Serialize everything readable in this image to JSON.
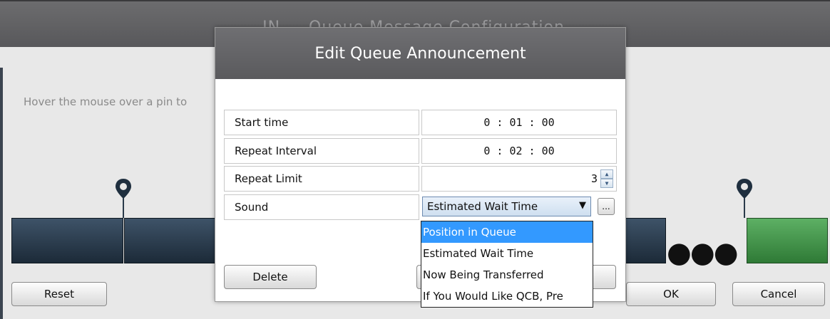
{
  "background": {
    "window_title": "IN ... Queue Message Configuration",
    "hint": "Hover the mouse over a pin to",
    "reset_label": "Reset",
    "ok_label": "OK",
    "cancel_label": "Cancel",
    "pin_icon": "map-pin-icon",
    "colors": {
      "dark_segment": "#1c2a38",
      "green_segment": "#2f7a36"
    }
  },
  "modal": {
    "title": "Edit Queue Announcement",
    "fields": {
      "start_time": {
        "label": "Start time",
        "value": "0 : 01 : 00"
      },
      "repeat_interval": {
        "label": "Repeat Interval",
        "value": "0 : 02 : 00"
      },
      "repeat_limit": {
        "label": "Repeat Limit",
        "value": "3"
      },
      "sound": {
        "label": "Sound",
        "value": "Estimated Wait Time",
        "browse": "..."
      }
    },
    "delete_label": "Delete",
    "dropdown": {
      "options": [
        "Position in Queue",
        "Estimated Wait Time",
        "Now Being Transferred",
        "If You Would Like QCB, Pre"
      ],
      "highlighted": "Position in Queue"
    }
  }
}
